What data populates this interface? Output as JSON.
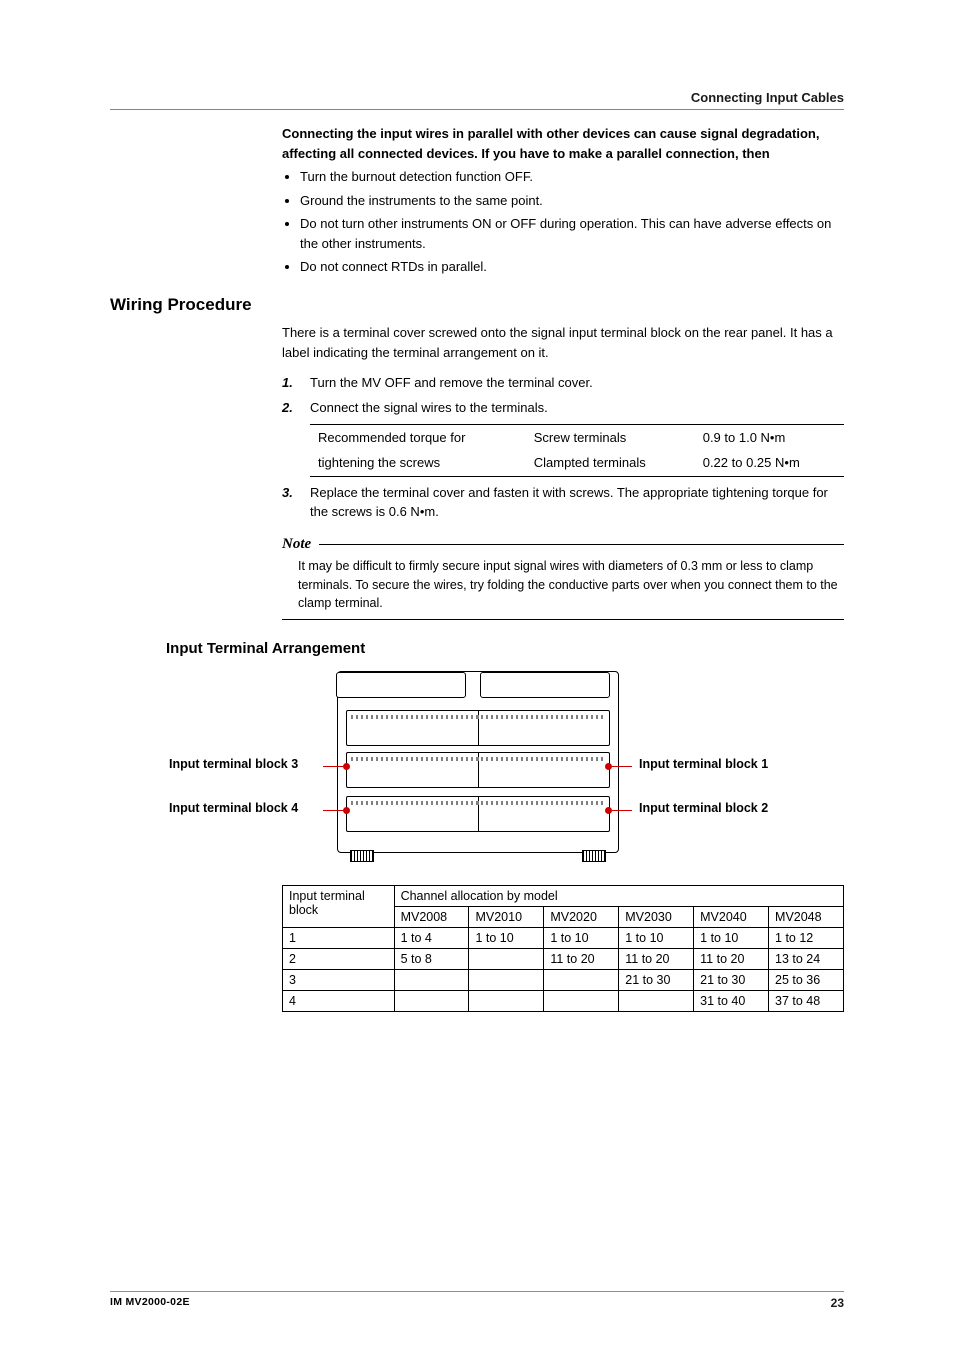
{
  "header": {
    "section_title": "Connecting Input Cables"
  },
  "warning": {
    "paragraph": "Connecting the input wires in parallel with other devices can cause signal degradation, affecting all connected devices. If you have to make a parallel connection, then",
    "bullets": [
      "Turn the burnout detection function OFF.",
      "Ground the instruments to the same point.",
      "Do not turn other instruments ON or OFF during operation. This can have adverse effects on the other instruments.",
      "Do not connect RTDs in parallel."
    ]
  },
  "wiring": {
    "heading": "Wiring Procedure",
    "intro": "There is a terminal cover screwed onto the signal input terminal block on the rear panel. It has a label indicating the terminal arrangement on it.",
    "steps": {
      "s1": "Turn the MV OFF and remove the terminal cover.",
      "s2": "Connect the signal wires to the terminals.",
      "s3": "Replace the terminal cover and fasten it with screws. The appropriate tightening torque for the screws is 0.6 N•m."
    },
    "torque": {
      "label": "Recommended torque for tightening the screws",
      "label_line1": "Recommended torque for",
      "label_line2": "tightening the screws",
      "screw_label": "Screw terminals",
      "screw_value": "0.9 to 1.0 N•m",
      "clamp_label": "Clampted terminals",
      "clamp_value": "0.22 to 0.25 N•m"
    }
  },
  "note": {
    "title": "Note",
    "body": "It may be difficult to firmly secure input signal wires with diameters of 0.3 mm or less to clamp terminals. To secure the wires, try folding the conductive parts over when you connect them to the clamp terminal."
  },
  "arrangement": {
    "heading": "Input Terminal Arrangement",
    "labels": {
      "b1": "Input terminal block 1",
      "b2": "Input terminal block 2",
      "b3": "Input terminal block 3",
      "b4": "Input terminal block 4"
    }
  },
  "grid": {
    "col0": "Input terminal block",
    "col0_line1": "Input terminal",
    "col0_line2": "block",
    "span": "Channel allocation by model",
    "models": [
      "MV2008",
      "MV2010",
      "MV2020",
      "MV2030",
      "MV2040",
      "MV2048"
    ],
    "rows": [
      {
        "n": "1",
        "cells": [
          "1 to 4",
          "1 to 10",
          "1 to 10",
          "1 to 10",
          "1 to 10",
          "1 to 12"
        ]
      },
      {
        "n": "2",
        "cells": [
          "5 to 8",
          "",
          "11 to 20",
          "11 to 20",
          "11 to 20",
          "13 to 24"
        ]
      },
      {
        "n": "3",
        "cells": [
          "",
          "",
          "",
          "21 to 30",
          "21 to 30",
          "25 to 36"
        ]
      },
      {
        "n": "4",
        "cells": [
          "",
          "",
          "",
          "",
          "31 to 40",
          "37 to 48"
        ]
      }
    ]
  },
  "footer": {
    "doc_id": "IM MV2000-02E",
    "page": "23"
  }
}
